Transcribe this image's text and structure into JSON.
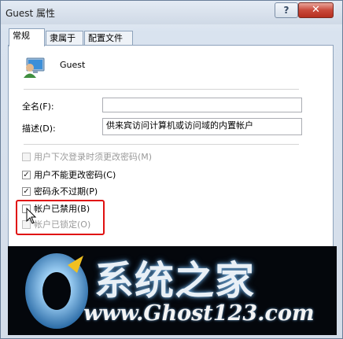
{
  "window": {
    "title": "Guest 属性",
    "help_label": "?",
    "close_label": "✕"
  },
  "tabs": [
    {
      "label": "常规",
      "active": true
    },
    {
      "label": "隶属于",
      "active": false
    },
    {
      "label": "配置文件",
      "active": false
    }
  ],
  "user": {
    "icon": "user-icon",
    "name": "Guest"
  },
  "fields": {
    "fullname_label": "全名(F):",
    "fullname_value": "",
    "description_label": "描述(D):",
    "description_value": "供来宾访问计算机或访问域的内置帐户"
  },
  "checkboxes": [
    {
      "label": "用户下次登录时须更改密码(M)",
      "checked": false,
      "disabled": true
    },
    {
      "label": "用户不能更改密码(C)",
      "checked": true,
      "disabled": false
    },
    {
      "label": "密码永不过期(P)",
      "checked": true,
      "disabled": false
    },
    {
      "label": "帐户已禁用(B)",
      "checked": false,
      "disabled": false
    },
    {
      "label": "帐户已锁定(O)",
      "checked": false,
      "disabled": true
    }
  ],
  "banner": {
    "brand": "系统之家",
    "url": "www.Ghost123.com"
  },
  "colors": {
    "highlight": "#e01010",
    "close_button": "#c9493a",
    "banner_bg": "#04070c"
  }
}
